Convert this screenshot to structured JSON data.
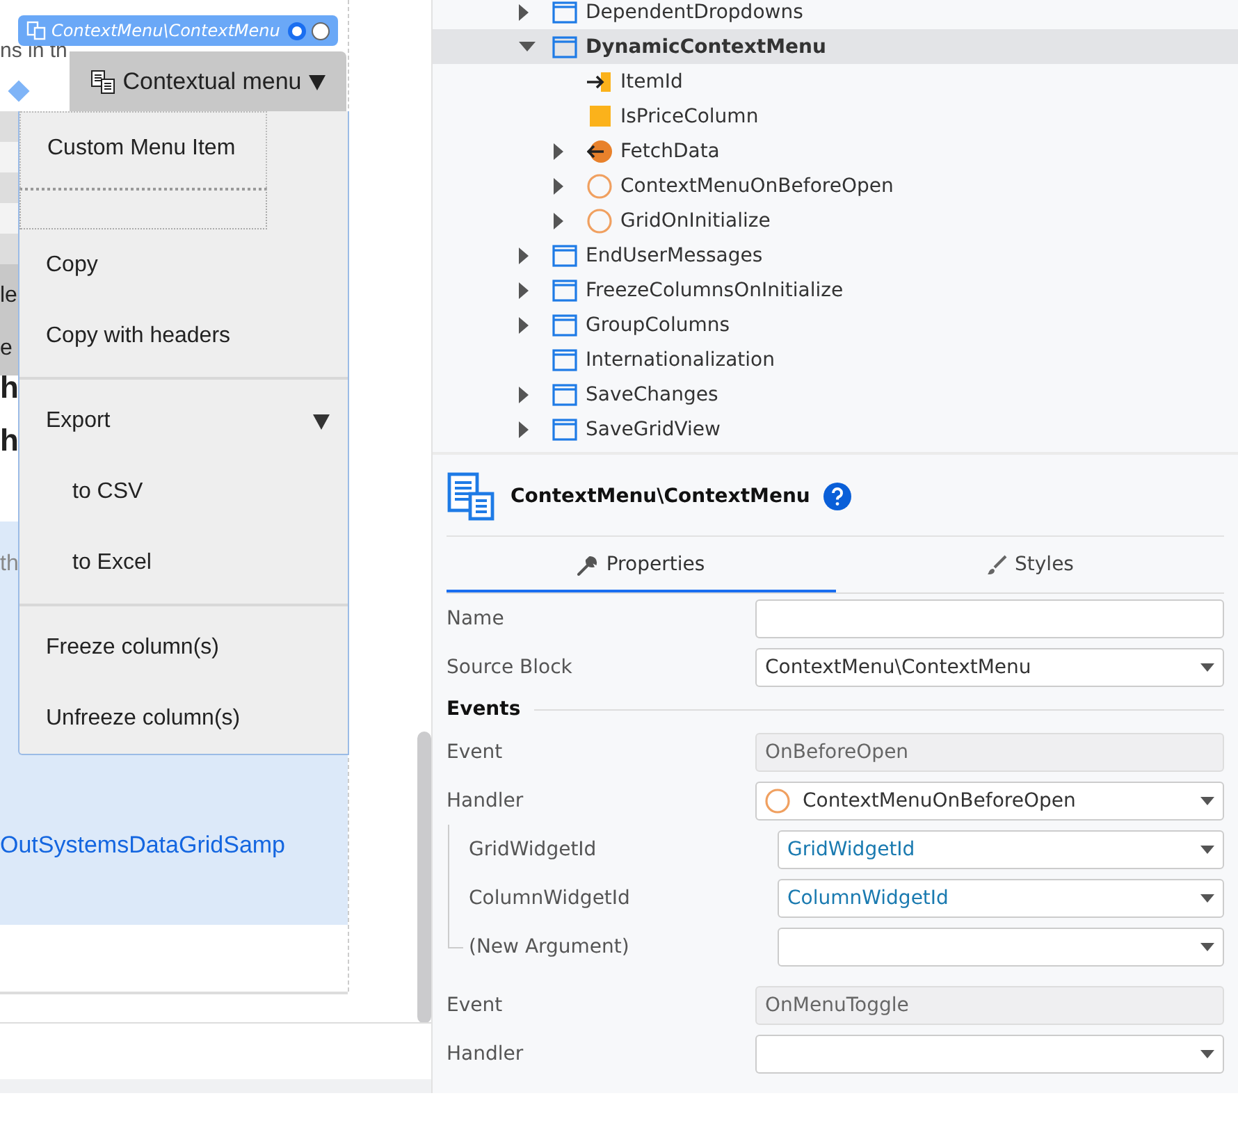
{
  "canvas": {
    "fragments": [
      {
        "text": "ns in th",
        "kind": "muted"
      },
      {
        "text": "le",
        "kind": "header"
      },
      {
        "text": "e",
        "kind": "header"
      },
      {
        "text": "h",
        "kind": "heading"
      },
      {
        "text": "h",
        "kind": "heading"
      },
      {
        "text": "th",
        "kind": "hint"
      }
    ],
    "link_text": "OutSystemsDataGridSamp",
    "block_tag": {
      "label": "ContextMenu\\ContextMenu",
      "radios": [
        {
          "selected": true
        },
        {
          "selected": false
        }
      ]
    },
    "menu": {
      "title": "Contextual menu",
      "items": [
        {
          "kind": "custom",
          "label": "Custom Menu Item"
        },
        {
          "kind": "placeholder"
        },
        {
          "kind": "item",
          "label": "Copy"
        },
        {
          "kind": "item",
          "label": "Copy with headers"
        },
        {
          "kind": "separator"
        },
        {
          "kind": "submenu",
          "label": "Export"
        },
        {
          "kind": "subitem",
          "label": "to CSV"
        },
        {
          "kind": "subitem",
          "label": "to Excel"
        },
        {
          "kind": "separator"
        },
        {
          "kind": "item",
          "label": "Freeze column(s)"
        },
        {
          "kind": "item",
          "label": "Unfreeze column(s)"
        }
      ]
    }
  },
  "tree": [
    {
      "label": "DependentDropdowns",
      "kind": "screen",
      "expanded": false,
      "selected": false
    },
    {
      "label": "DynamicContextMenu",
      "kind": "screen",
      "expanded": true,
      "selected": true,
      "children": [
        {
          "label": "ItemId",
          "kind": "input",
          "selected": false
        },
        {
          "label": "IsPriceColumn",
          "kind": "variable",
          "selected": false
        },
        {
          "label": "FetchData",
          "kind": "data-action",
          "expanded": false,
          "selected": false
        },
        {
          "label": "ContextMenuOnBeforeOpen",
          "kind": "client-action",
          "expanded": false,
          "selected": false
        },
        {
          "label": "GridOnInitialize",
          "kind": "client-action",
          "expanded": false,
          "selected": false
        }
      ]
    },
    {
      "label": "EndUserMessages",
      "kind": "screen",
      "expanded": false,
      "selected": false
    },
    {
      "label": "FreezeColumnsOnInitialize",
      "kind": "screen",
      "expanded": false,
      "selected": false
    },
    {
      "label": "GroupColumns",
      "kind": "screen",
      "expanded": false,
      "selected": false
    },
    {
      "label": "Internationalization",
      "kind": "screen",
      "selected": false
    },
    {
      "label": "SaveChanges",
      "kind": "screen",
      "expanded": false,
      "selected": false
    },
    {
      "label": "SaveGridView",
      "kind": "screen",
      "expanded": false,
      "selected": false
    }
  ],
  "properties": {
    "title": "ContextMenu\\ContextMenu",
    "tabs": [
      {
        "label": "Properties",
        "kind": "wrench",
        "selected": true
      },
      {
        "label": "Styles",
        "kind": "brush",
        "selected": false
      }
    ],
    "rows": [
      {
        "kind": "text",
        "label": "Name"
      },
      {
        "kind": "select",
        "label": "Source Block",
        "value": {
          "kind": "plain",
          "text": "ContextMenu\\ContextMenu"
        }
      },
      {
        "kind": "section",
        "label": "Events"
      },
      {
        "kind": "readonly",
        "label": "Event",
        "value": "OnBeforeOpen"
      },
      {
        "kind": "select",
        "label": "Handler",
        "value": {
          "kind": "client-action",
          "text": "ContextMenuOnBeforeOpen"
        },
        "children": [
          {
            "kind": "select",
            "label": "GridWidgetId",
            "value": {
              "kind": "reference",
              "text": "GridWidgetId"
            }
          },
          {
            "kind": "select",
            "label": "ColumnWidgetId",
            "value": {
              "kind": "reference",
              "text": "ColumnWidgetId"
            }
          },
          {
            "kind": "select",
            "label": "(New Argument)"
          }
        ]
      },
      {
        "kind": "gap"
      },
      {
        "kind": "readonly",
        "label": "Event",
        "value": "OnMenuToggle"
      },
      {
        "kind": "select",
        "label": "Handler"
      }
    ]
  }
}
